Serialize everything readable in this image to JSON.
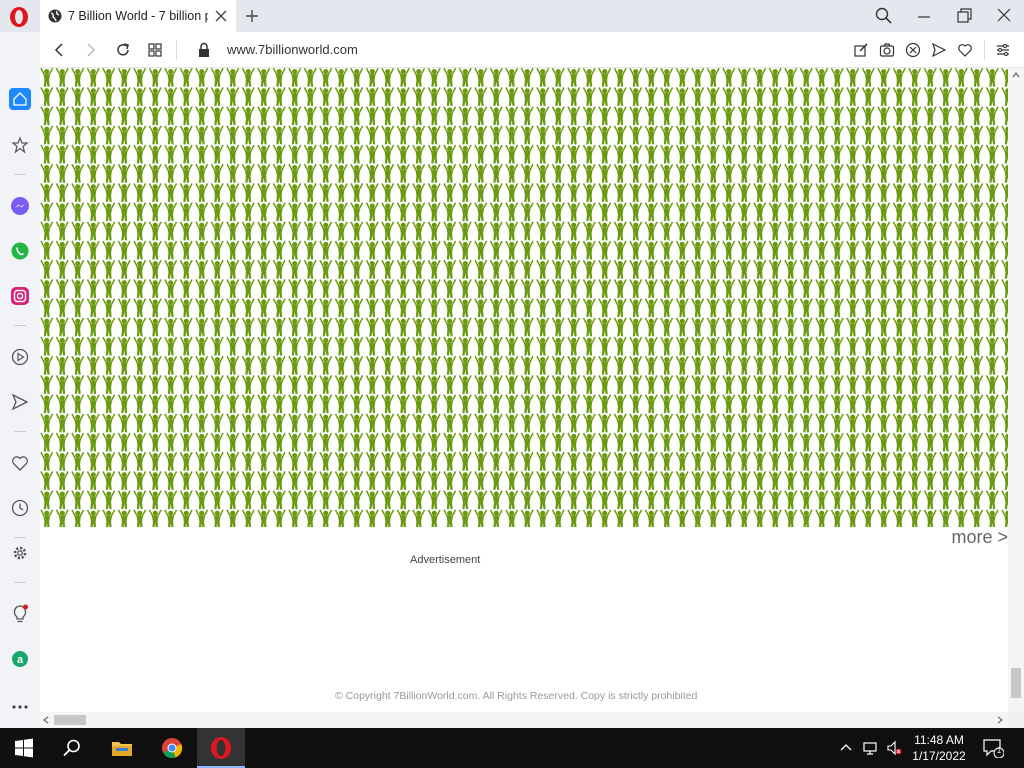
{
  "browser": {
    "tab": {
      "title": "7 Billion World - 7 billion p"
    },
    "url": "www.7billionworld.com"
  },
  "content": {
    "more_link": "more >",
    "ad_label": "Advertisement",
    "copyright": "© Copyright 7BillionWorld.com. All Rights Reserved. Copy is strictly prohibited"
  },
  "taskbar": {
    "time": "11:48 AM",
    "date": "1/17/2022",
    "notification_count": "1"
  },
  "colors": {
    "people_green": "#6a9a10",
    "opera_red": "#e0161e"
  }
}
